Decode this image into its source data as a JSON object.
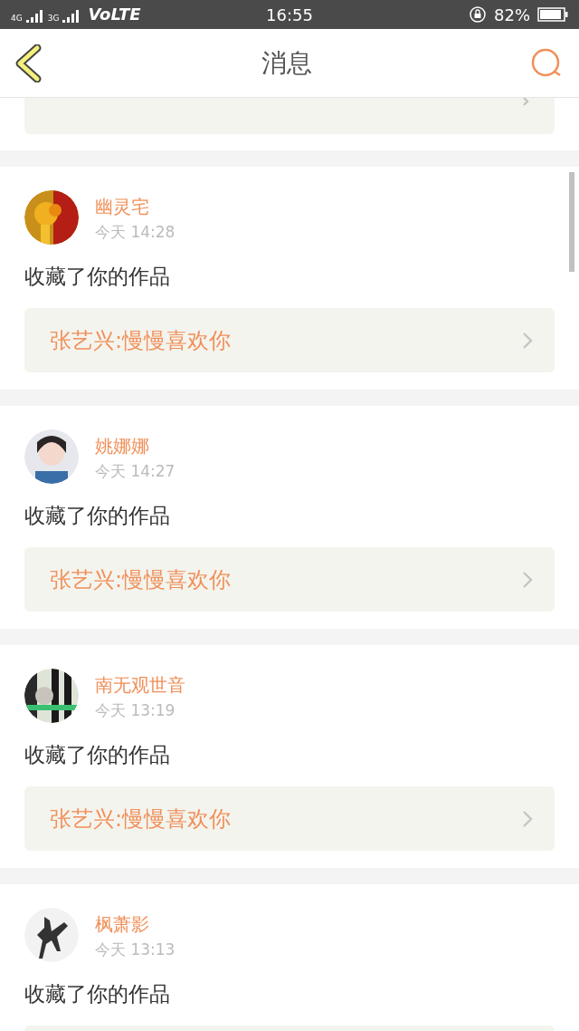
{
  "status_bar": {
    "network_1": "4G",
    "network_2": "3G",
    "carrier": "VoLTE",
    "time": "16:55",
    "battery": "82%"
  },
  "header": {
    "title": "消息"
  },
  "messages": [
    {
      "user": "幽灵宅",
      "time": "今天 14:28",
      "action": "收藏了你的作品",
      "link": "张艺兴:慢慢喜欢你"
    },
    {
      "user": "姚娜娜",
      "time": "今天 14:27",
      "action": "收藏了你的作品",
      "link": "张艺兴:慢慢喜欢你"
    },
    {
      "user": "南无观世音",
      "time": "今天 13:19",
      "action": "收藏了你的作品",
      "link": "张艺兴:慢慢喜欢你"
    },
    {
      "user": "枫萧影",
      "time": "今天 13:13",
      "action": "收藏了你的作品"
    }
  ]
}
